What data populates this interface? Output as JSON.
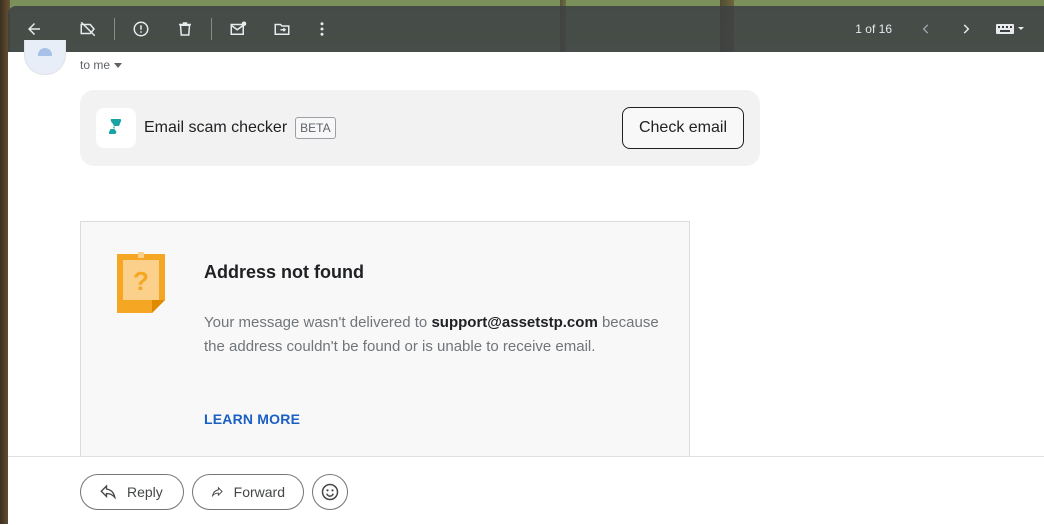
{
  "toolbar": {
    "icons": [
      "back-arrow-icon",
      "label-off-icon",
      "report-spam-icon",
      "delete-icon",
      "mark-unread-icon",
      "move-to-icon",
      "more-vert-icon"
    ],
    "pager": "1 of 16"
  },
  "header": {
    "recipient": "to me"
  },
  "scam_checker": {
    "title": "Email scam checker",
    "badge": "BETA",
    "button": "Check email",
    "accent": "#1aa3a3"
  },
  "bounce": {
    "title": "Address not found",
    "message_prefix": "Your message wasn't delivered to ",
    "address": "support@assetstp.com",
    "message_suffix": " because the address couldn't be found or is unable to receive email.",
    "link": "LEARN MORE",
    "icon_color": "#f5a623"
  },
  "actions": {
    "reply": "Reply",
    "forward": "Forward"
  }
}
